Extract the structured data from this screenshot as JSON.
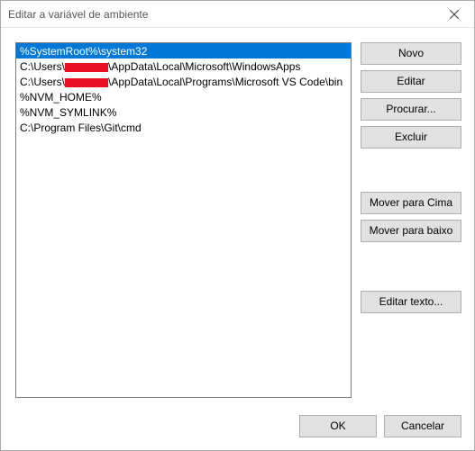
{
  "window": {
    "title": "Editar a variável de ambiente"
  },
  "paths": {
    "items": [
      {
        "text": "%SystemRoot%\\system32",
        "selected": true,
        "redacted": false
      },
      {
        "prefix": "C:\\Users\\",
        "suffix": "\\AppData\\Local\\Microsoft\\WindowsApps",
        "selected": false,
        "redacted": true
      },
      {
        "prefix": "C:\\Users\\",
        "suffix": "\\AppData\\Local\\Programs\\Microsoft VS Code\\bin",
        "selected": false,
        "redacted": true
      },
      {
        "text": "%NVM_HOME%",
        "selected": false,
        "redacted": false
      },
      {
        "text": "%NVM_SYMLINK%",
        "selected": false,
        "redacted": false
      },
      {
        "text": "C:\\Program Files\\Git\\cmd",
        "selected": false,
        "redacted": false
      }
    ]
  },
  "buttons": {
    "new": "Novo",
    "edit": "Editar",
    "browse": "Procurar...",
    "delete": "Excluir",
    "moveUp": "Mover para Cima",
    "moveDown": "Mover para baixo",
    "editText": "Editar texto...",
    "ok": "OK",
    "cancel": "Cancelar"
  }
}
